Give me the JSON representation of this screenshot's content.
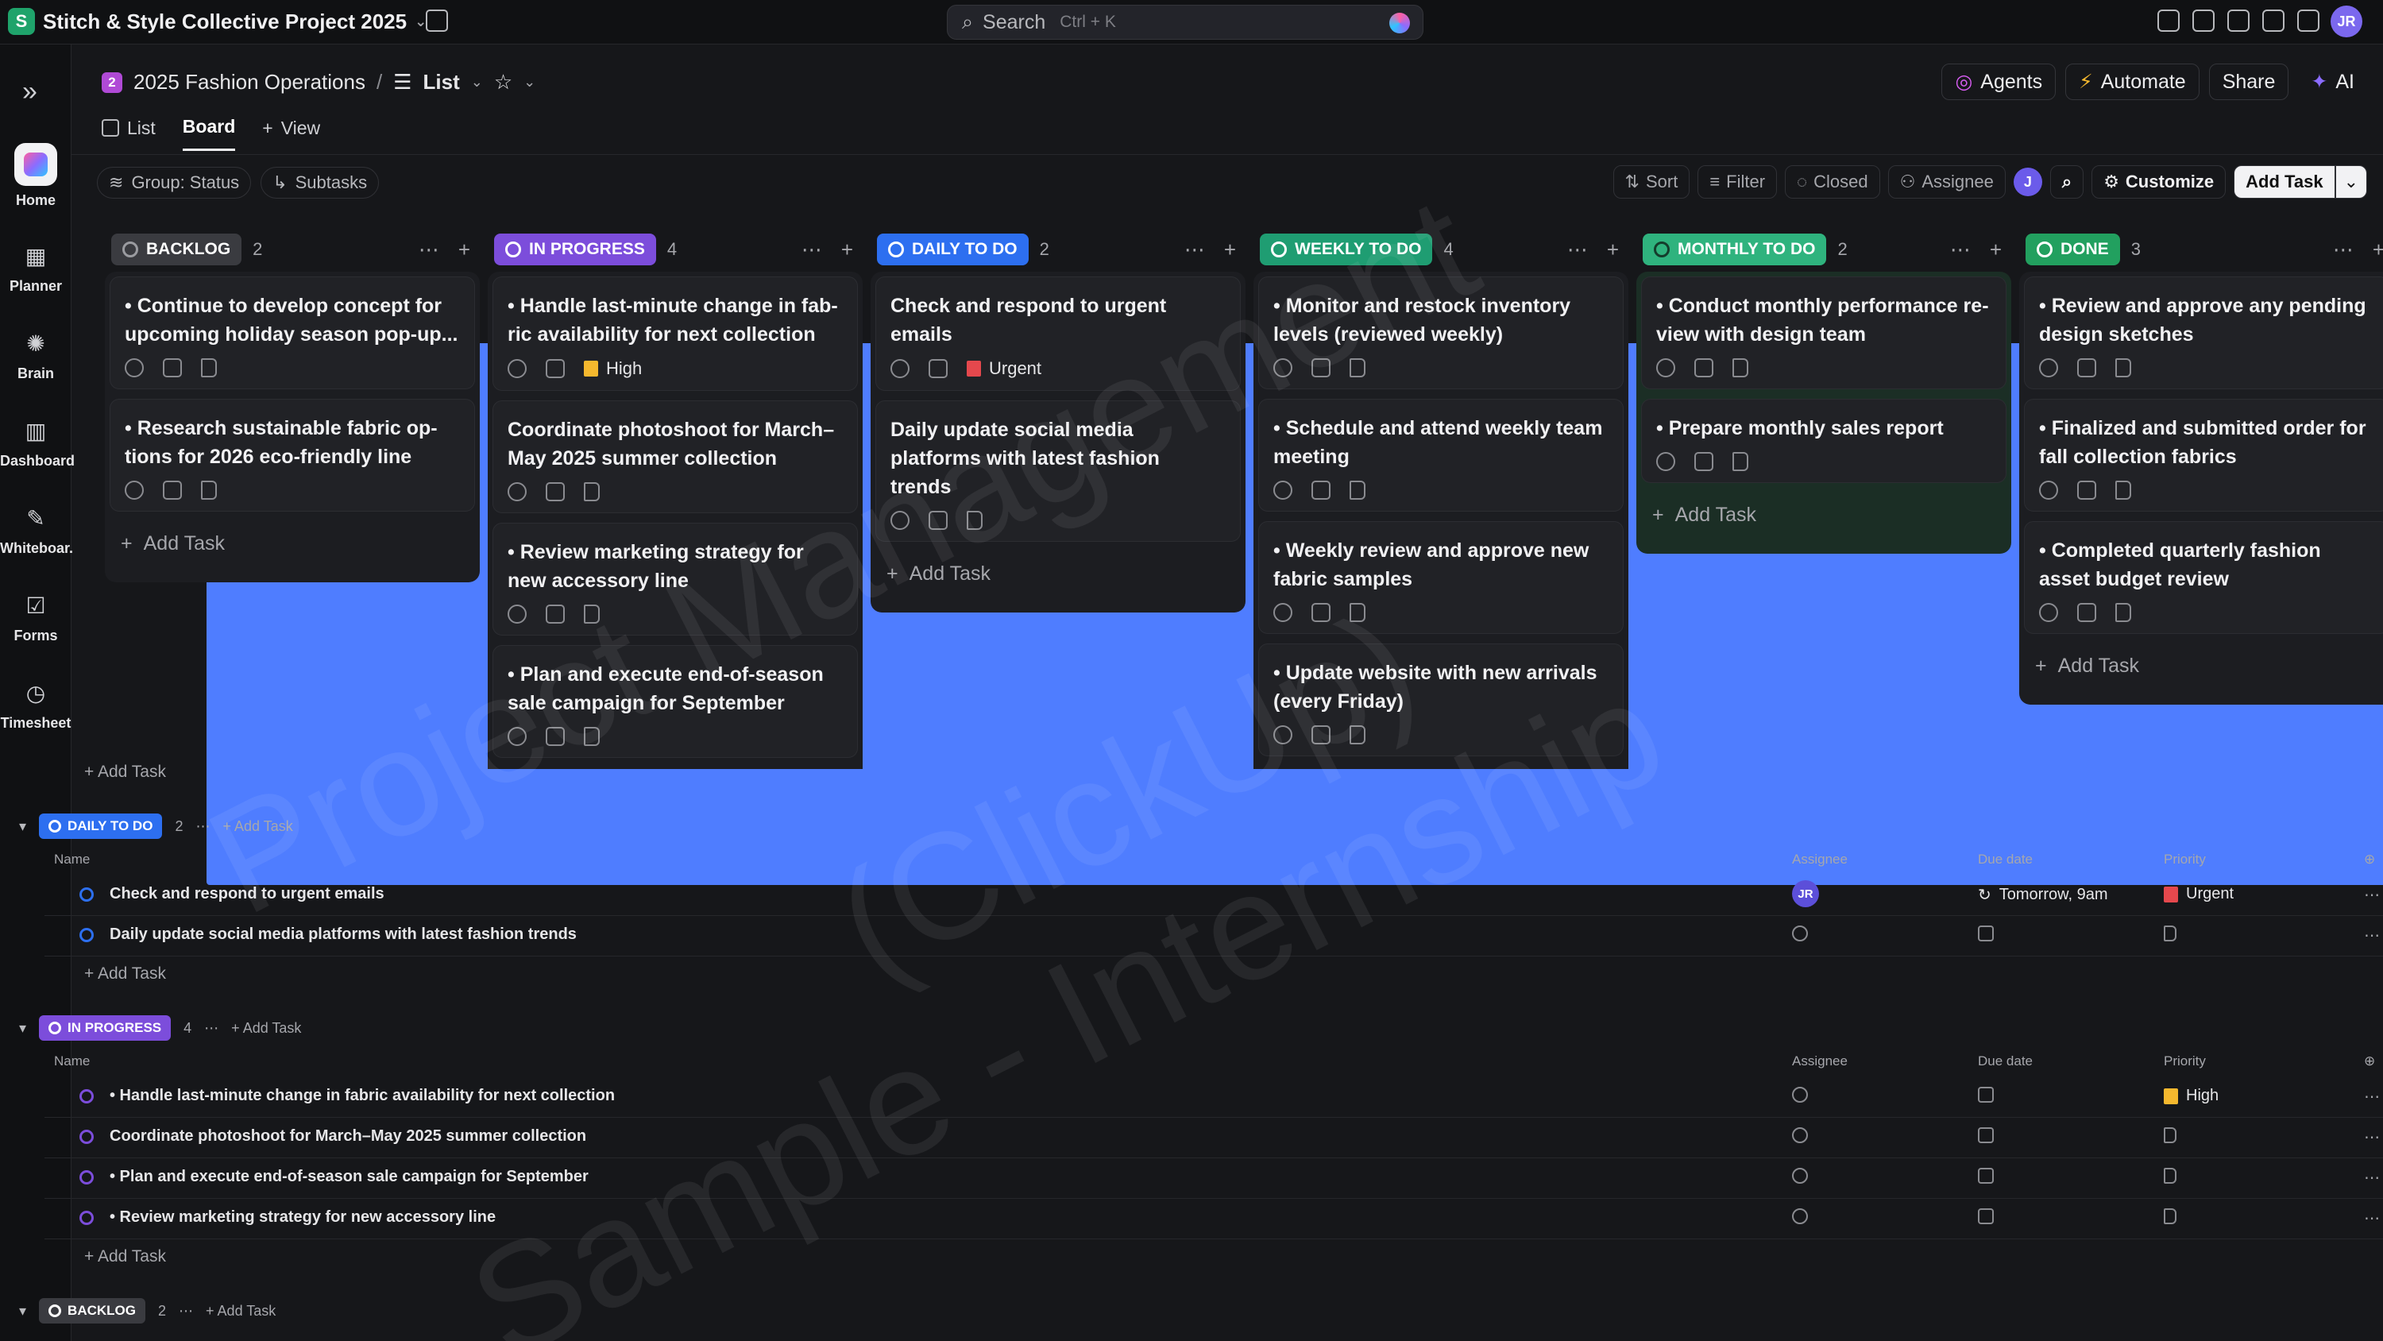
{
  "workspace": {
    "initial": "S",
    "name": "Stitch & Style Collective Project 2025"
  },
  "search": {
    "label": "Search",
    "shortcut": "Ctrl + K"
  },
  "user": {
    "initials": "JR"
  },
  "rail": [
    {
      "key": "home",
      "label": "Home"
    },
    {
      "key": "planner",
      "label": "Planner"
    },
    {
      "key": "brain",
      "label": "Brain"
    },
    {
      "key": "dashboard",
      "label": "Dashboard"
    },
    {
      "key": "whiteboard",
      "label": "Whiteboar."
    },
    {
      "key": "forms",
      "label": "Forms"
    },
    {
      "key": "timesheet",
      "label": "Timesheet"
    }
  ],
  "breadcrumb": {
    "space_initial": "2",
    "space": "2025 Fashion Operations",
    "view": "List"
  },
  "header_actions": {
    "agents": "Agents",
    "automate": "Automate",
    "share": "Share",
    "ai": "AI"
  },
  "tabs": {
    "list": "List",
    "board": "Board",
    "view": "View"
  },
  "toolbar": {
    "group": "Group: Status",
    "subtasks": "Subtasks",
    "sort": "Sort",
    "filter": "Filter",
    "closed": "Closed",
    "assignee": "Assignee",
    "avatar": "J",
    "customize": "Customize",
    "add_task": "Add Task"
  },
  "columns": [
    {
      "key": "backlog",
      "label": "BACKLOG",
      "count": "2",
      "color": "#3a3b40",
      "ring": "#9a9ba0",
      "tint": "#1c1d21",
      "cards": [
        {
          "title": "• Continue to develop concept for upcoming holiday season pop-up..."
        },
        {
          "title": "• Research sustainable fabric op­tions for 2026 eco-friendly line"
        }
      ],
      "add": "Add Task"
    },
    {
      "key": "inprogress",
      "label": "IN PROGRESS",
      "count": "4",
      "color": "#7c4ddb",
      "ring": "#ffffff",
      "tint": "#1c1d21",
      "cards": [
        {
          "title": "• Handle last-minute change in fab­ric availability for next collection",
          "priority": "High",
          "pcolor": "#f5b82e"
        },
        {
          "title": "Coordinate photoshoot for March–May 2025 summer collection"
        },
        {
          "title": "• Review marketing strategy for new accessory line"
        },
        {
          "title": "• Plan and execute end-of-season sale campaign for September"
        }
      ],
      "add": "Add Task"
    },
    {
      "key": "daily",
      "label": "DAILY TO DO",
      "count": "2",
      "color": "#2d6ff0",
      "ring": "#ffffff",
      "tint": "#1c1d21",
      "cards": [
        {
          "title": "Check and respond to urgent emails",
          "priority": "Urgent",
          "pcolor": "#e5484d"
        },
        {
          "title": "Daily update social media platforms with latest fashion trends"
        }
      ],
      "add": "Add Task"
    },
    {
      "key": "weekly",
      "label": "WEEKLY TO DO",
      "count": "4",
      "color": "#1f9d72",
      "ring": "#ffffff",
      "tint": "#1c1d21",
      "cards": [
        {
          "title": "• Monitor and restock inventory lev­els (reviewed weekly)"
        },
        {
          "title": "• Schedule and attend weekly team meeting"
        },
        {
          "title": "• Weekly review and approve new fabric samples"
        },
        {
          "title": "• Update website with new arrivals (every Friday)"
        }
      ],
      "add": "Add Task"
    },
    {
      "key": "monthly",
      "label": "MONTHLY TO DO",
      "count": "2",
      "color": "#2fb37e",
      "ring": "#143d2c",
      "tint": "#1b2e25",
      "cards": [
        {
          "title": "• Conduct monthly performance re­view with design team"
        },
        {
          "title": "• Prepare monthly sales report"
        }
      ],
      "add": "Add Task"
    },
    {
      "key": "done",
      "label": "DONE",
      "count": "3",
      "color": "#22a05f",
      "ring": "#ffffff",
      "tint": "#1c1d21",
      "cards": [
        {
          "title": "• Review and approve any pending design sketches"
        },
        {
          "title": "• Finalized and submitted order for fall collection fabrics"
        },
        {
          "title": "• Completed quarterly fashion asset budget review"
        }
      ],
      "add": "Add Task"
    }
  ],
  "list": {
    "overflow_add": "Add Task",
    "headers": {
      "name": "Name",
      "assignee": "Assignee",
      "due": "Due date",
      "priority": "Priority"
    },
    "groups": [
      {
        "label": "DAILY TO DO",
        "count": "2",
        "color": "#2d6ff0",
        "add": "Add Task",
        "rows": [
          {
            "name": "Check and respond to urgent emails",
            "assignee": "JR",
            "due": "Tomorrow, 9am",
            "priority": "Urgent",
            "pcolor": "#e5484d"
          },
          {
            "name": "Daily update social media platforms with latest fashion trends"
          }
        ]
      },
      {
        "label": "IN PROGRESS",
        "count": "4",
        "color": "#7c4ddb",
        "add": "Add Task",
        "rows": [
          {
            "name": "• Handle last-minute change in fabric availability for next collection",
            "priority": "High",
            "pcolor": "#f5b82e"
          },
          {
            "name": "Coordinate photoshoot for March–May 2025 summer collection"
          },
          {
            "name": "• Plan and execute end-of-season sale campaign for September"
          },
          {
            "name": "• Review marketing strategy for new accessory line"
          }
        ]
      },
      {
        "label": "BACKLOG",
        "count": "2",
        "color": "#3a3b40",
        "add": "Add Task",
        "rows": []
      }
    ]
  },
  "watermark": {
    "line1": "Project Management",
    "line2": "(ClickUp)",
    "line3": "Sample - Internship"
  }
}
